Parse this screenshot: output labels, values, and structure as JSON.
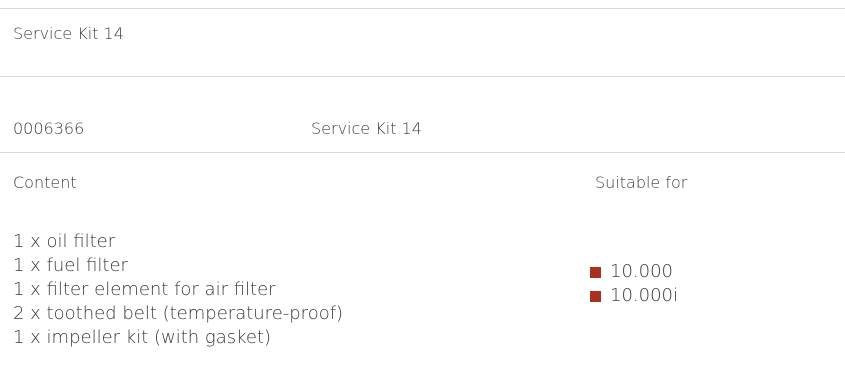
{
  "header": {
    "title": "Service Kit 14"
  },
  "product": {
    "number": "0006366",
    "name": "Service Kit 14"
  },
  "columns": {
    "content": "Content",
    "suitable_for": "Suitable for"
  },
  "content_items": [
    "1 x oil filter",
    "1 x fuel filter",
    "1 x filter element for air filter",
    "2 x toothed belt (temperature-proof)",
    "1 x impeller kit (with gasket)"
  ],
  "suitable_items": [
    "10.000",
    "10.000i"
  ],
  "colors": {
    "bullet": "#a8321e",
    "divider": "#d9d9d9",
    "text": "#3a3a3a"
  }
}
